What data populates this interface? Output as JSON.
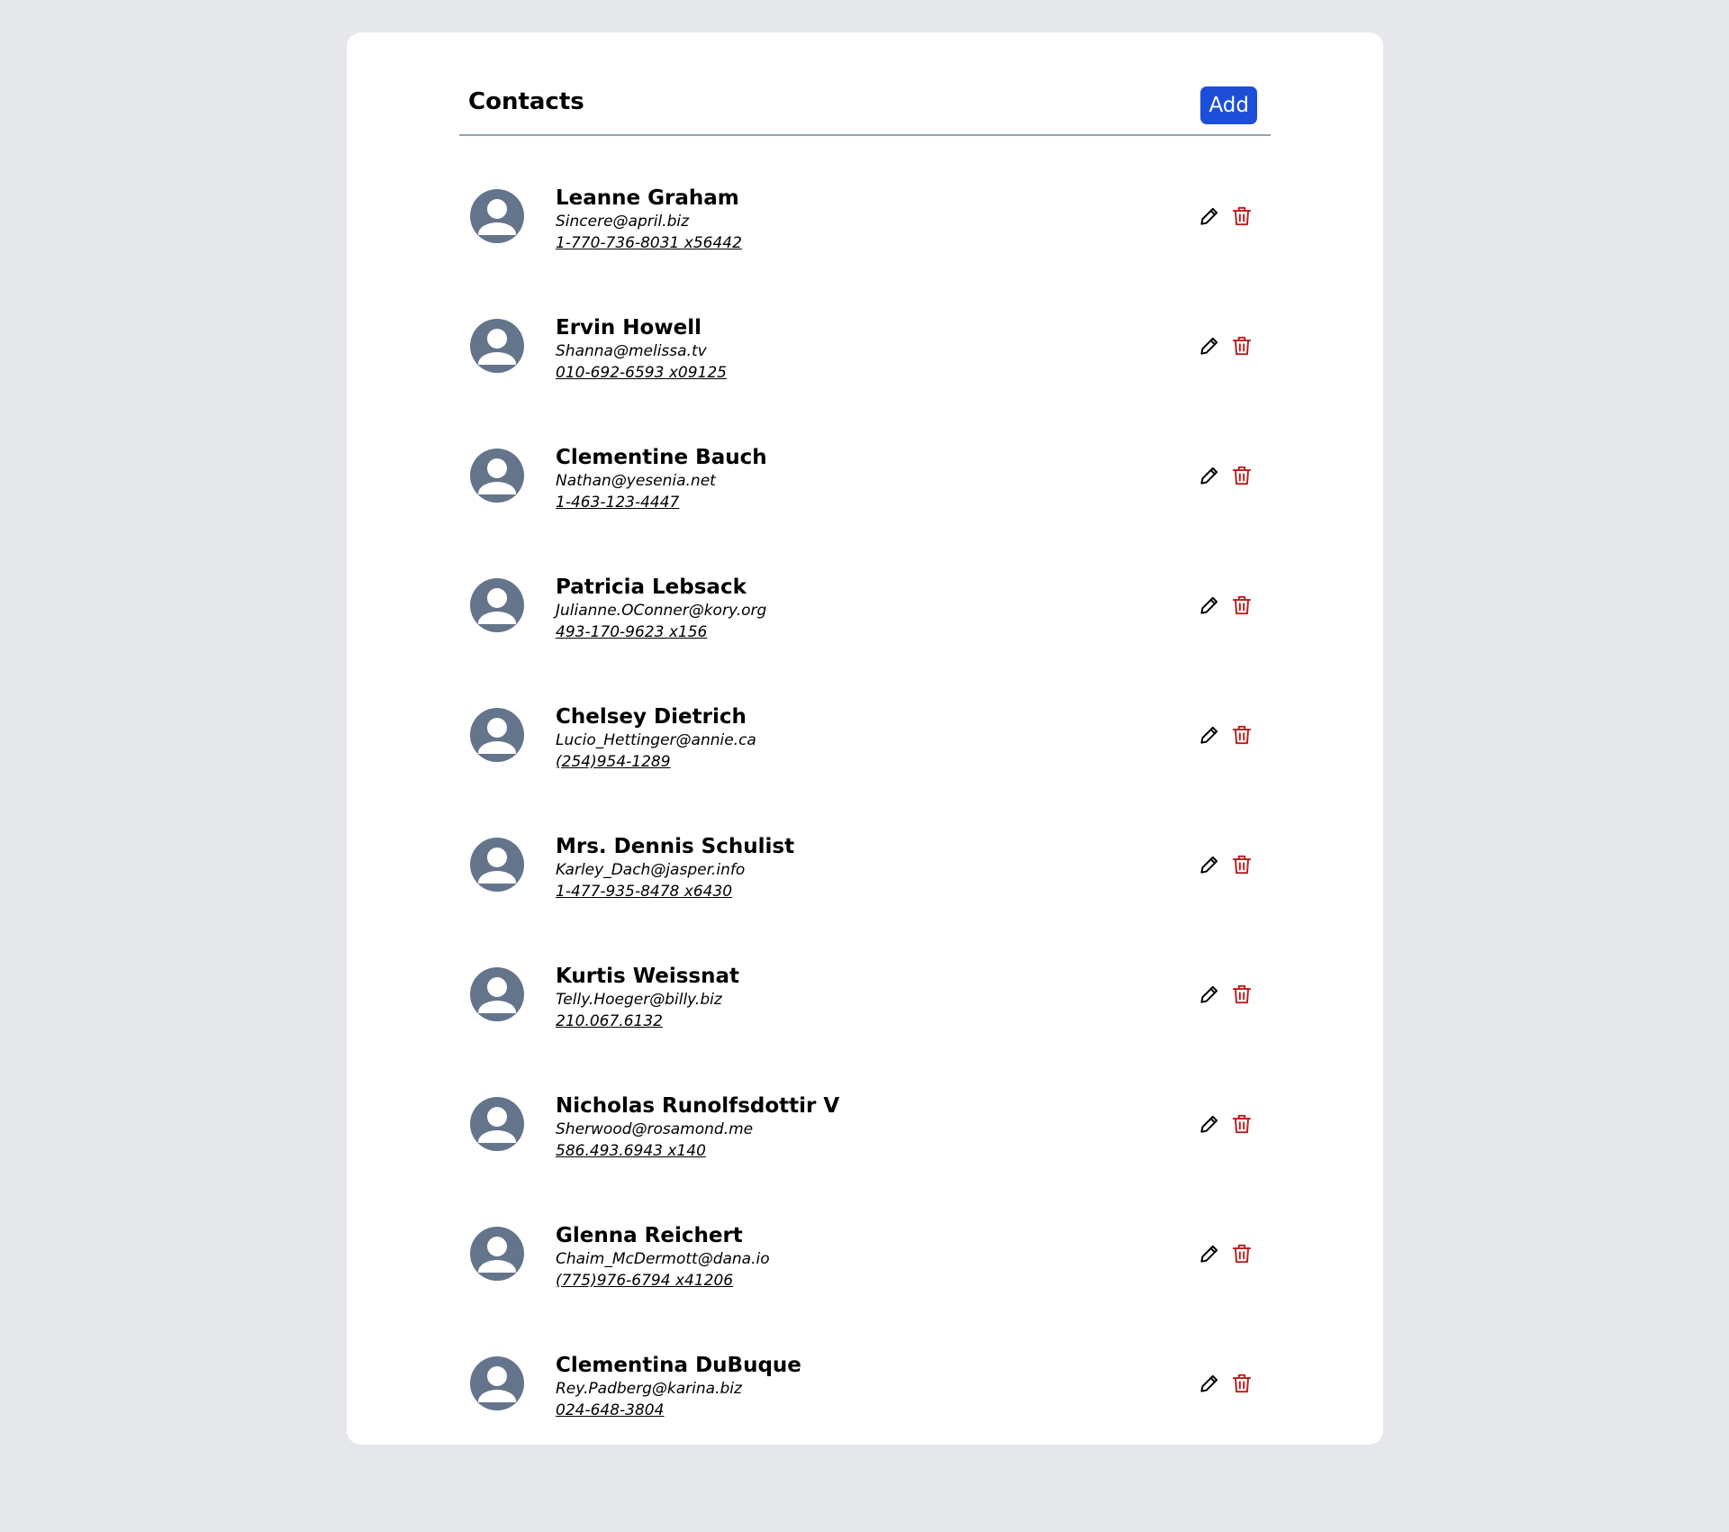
{
  "page": {
    "title": "Contacts",
    "add_label": "Add"
  },
  "colors": {
    "background": "#e5e7eb",
    "card": "#ffffff",
    "accent": "#1d4ed8",
    "avatar": "#64748b",
    "delete": "#b91c1c"
  },
  "icons": {
    "avatar": "user-avatar-icon",
    "edit": "pencil-icon",
    "delete": "trash-icon"
  },
  "contacts": [
    {
      "name": "Leanne Graham",
      "email": "Sincere@april.biz",
      "phone": "1-770-736-8031 x56442"
    },
    {
      "name": "Ervin Howell",
      "email": "Shanna@melissa.tv",
      "phone": "010-692-6593 x09125"
    },
    {
      "name": "Clementine Bauch",
      "email": "Nathan@yesenia.net",
      "phone": "1-463-123-4447"
    },
    {
      "name": "Patricia Lebsack",
      "email": "Julianne.OConner@kory.org",
      "phone": "493-170-9623 x156"
    },
    {
      "name": "Chelsey Dietrich",
      "email": "Lucio_Hettinger@annie.ca",
      "phone": "(254)954-1289"
    },
    {
      "name": "Mrs. Dennis Schulist",
      "email": "Karley_Dach@jasper.info",
      "phone": "1-477-935-8478 x6430"
    },
    {
      "name": "Kurtis Weissnat",
      "email": "Telly.Hoeger@billy.biz",
      "phone": "210.067.6132"
    },
    {
      "name": "Nicholas Runolfsdottir V",
      "email": "Sherwood@rosamond.me",
      "phone": "586.493.6943 x140"
    },
    {
      "name": "Glenna Reichert",
      "email": "Chaim_McDermott@dana.io",
      "phone": "(775)976-6794 x41206"
    },
    {
      "name": "Clementina DuBuque",
      "email": "Rey.Padberg@karina.biz",
      "phone": "024-648-3804"
    }
  ]
}
